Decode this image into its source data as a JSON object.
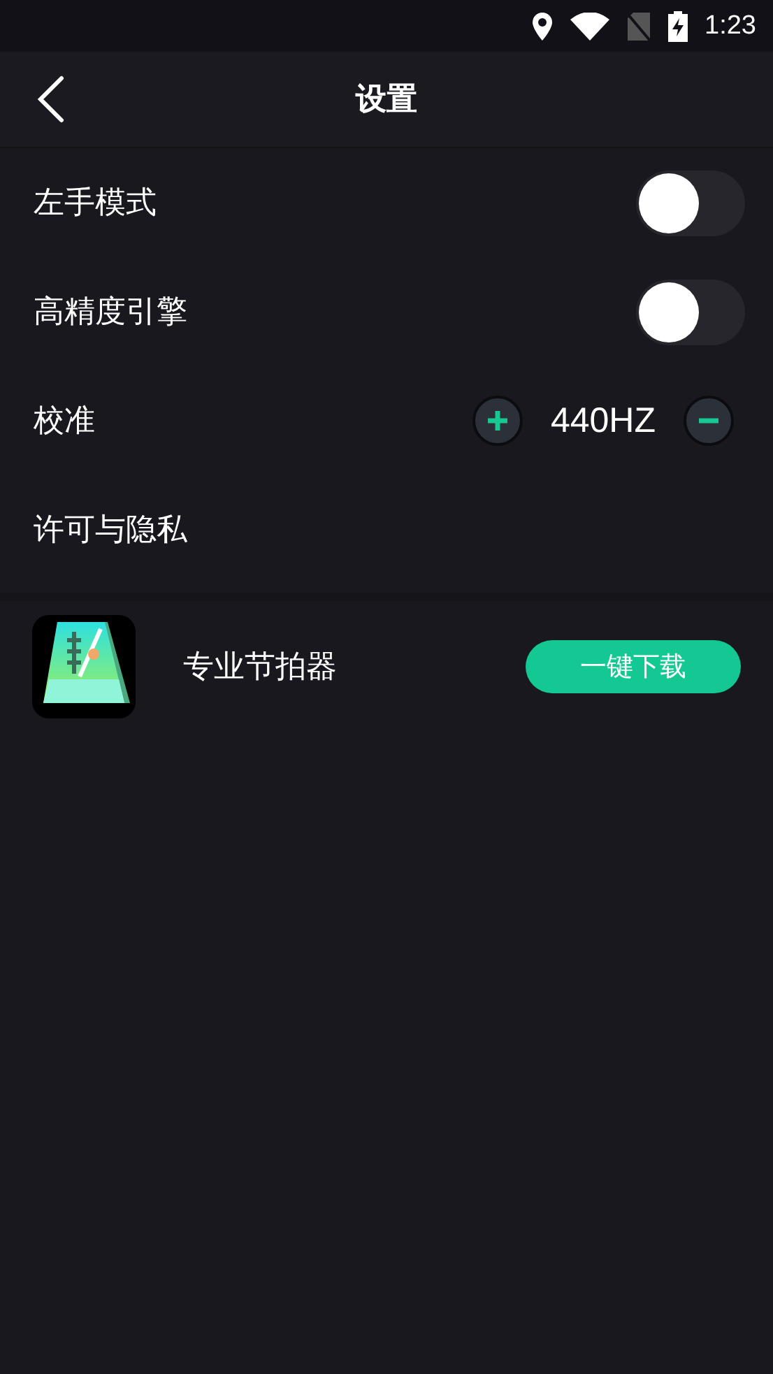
{
  "status_bar": {
    "time": "1:23"
  },
  "header": {
    "title": "设置"
  },
  "settings": [
    {
      "kind": "toggle",
      "label": "左手模式",
      "on": false
    },
    {
      "kind": "toggle",
      "label": "高精度引擎",
      "on": false
    },
    {
      "kind": "stepper",
      "label": "校准",
      "value": "440HZ"
    },
    {
      "kind": "link",
      "label": "许可与隐私"
    }
  ],
  "promo": {
    "name": "专业节拍器",
    "button": "一键下载"
  }
}
